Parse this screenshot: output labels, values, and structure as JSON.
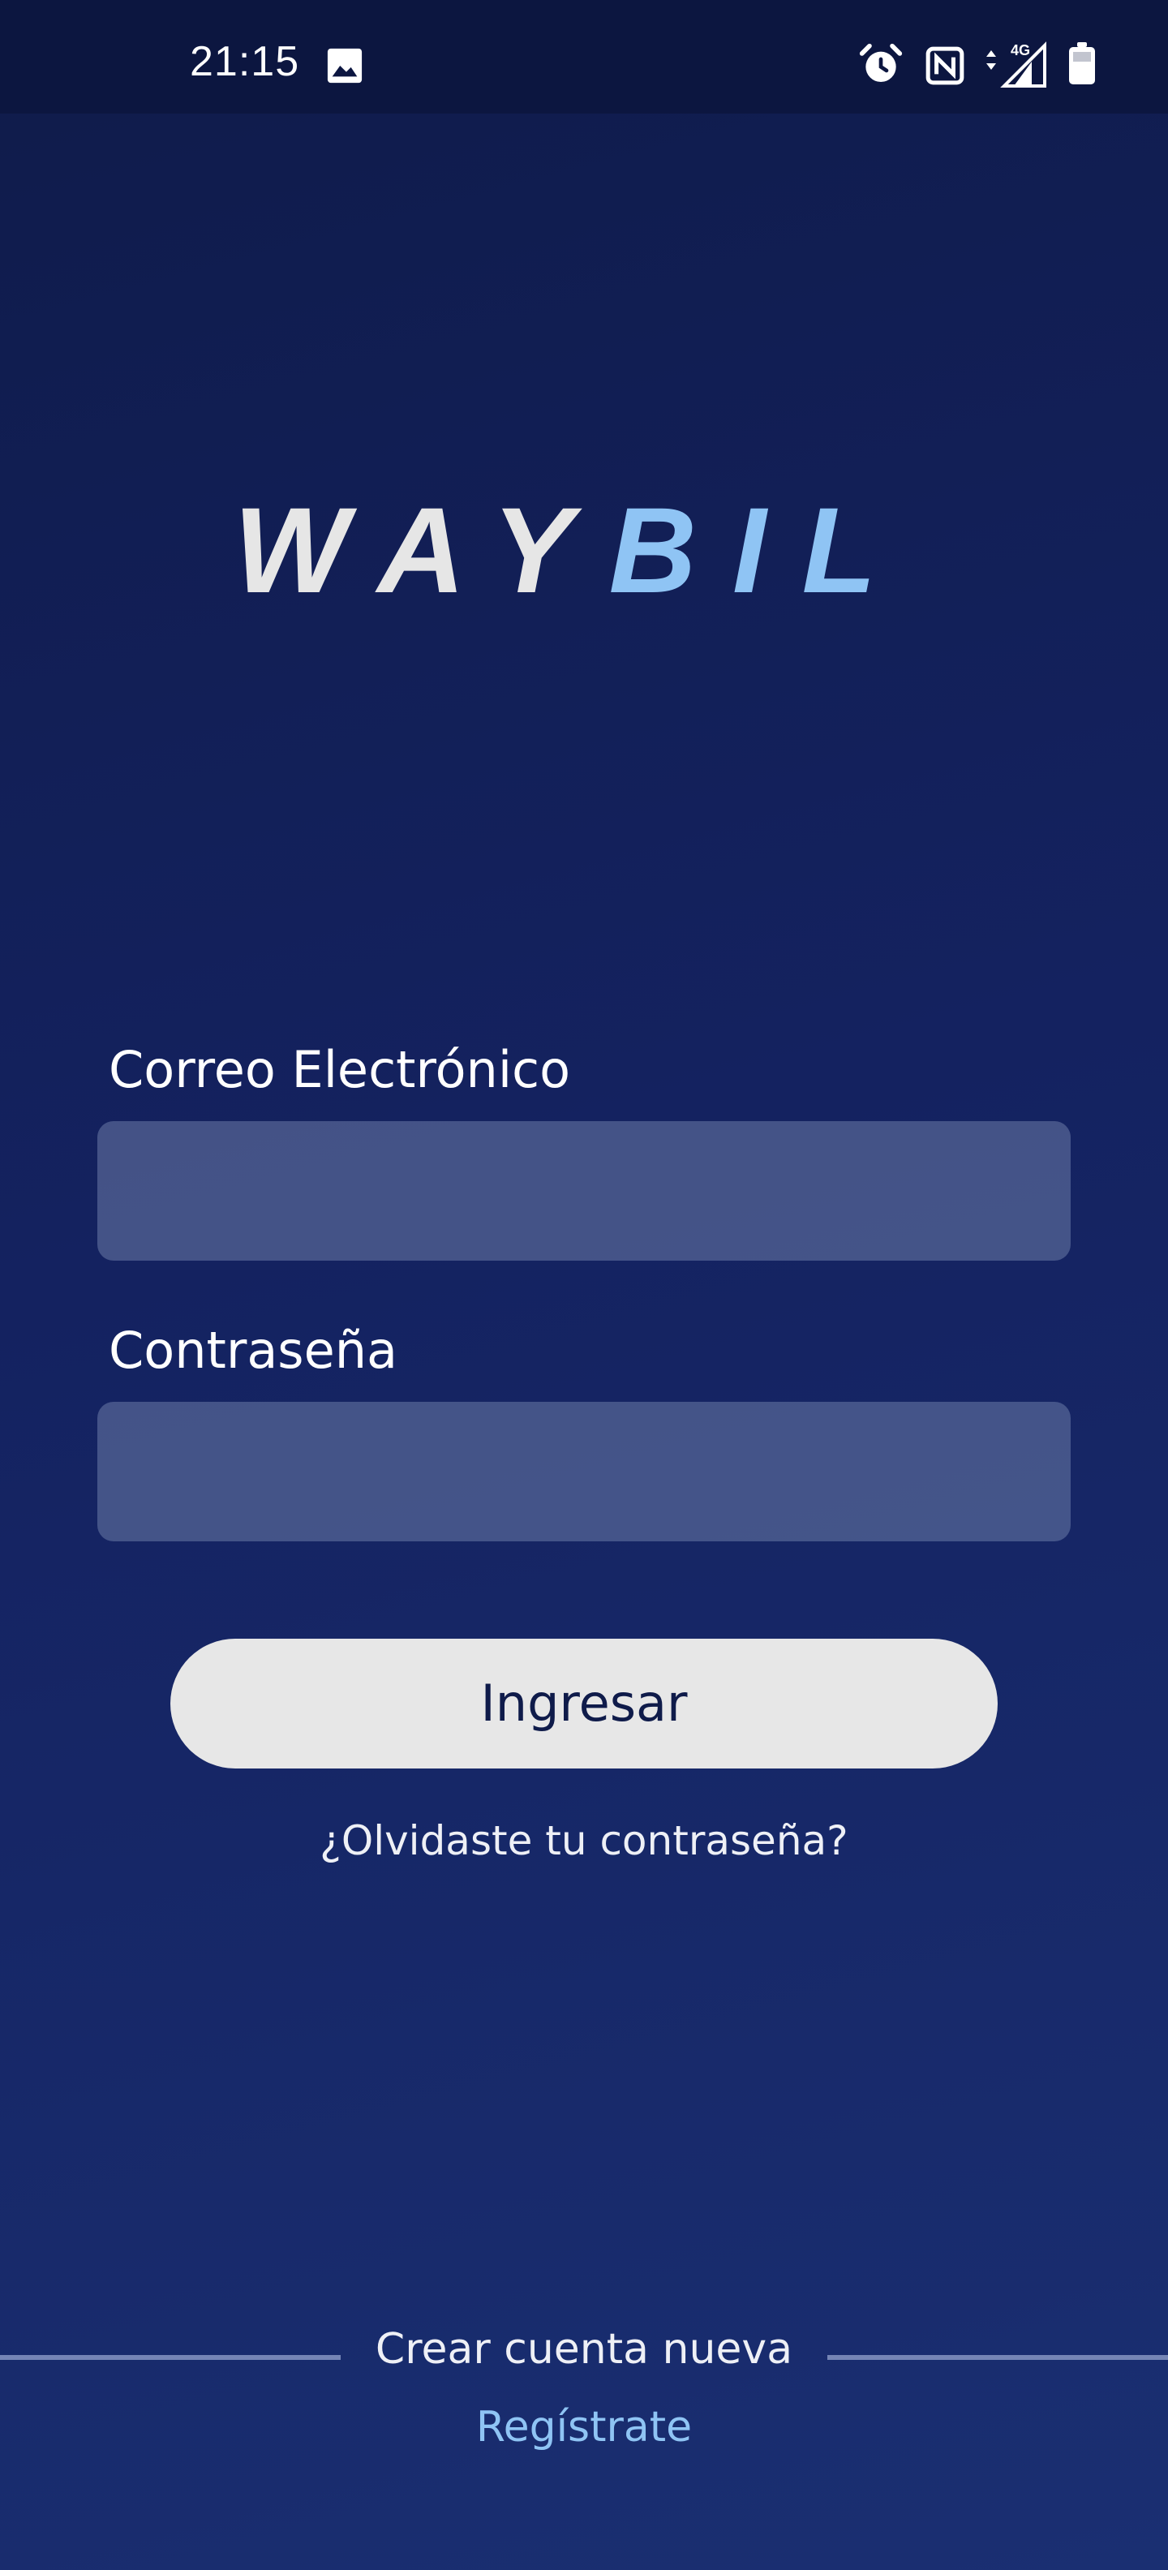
{
  "status_bar": {
    "time": "21:15",
    "icons": [
      "image-icon",
      "alarm-icon",
      "nfc-icon",
      "signal-4g-icon",
      "battery-icon"
    ],
    "network": "4G"
  },
  "logo": {
    "text_part1": "WAY",
    "text_part2": "BIL",
    "color_part1": "#e6e6e6",
    "color_part2": "#8fc4f4"
  },
  "form": {
    "email_label": "Correo Electrónico",
    "email_value": "",
    "password_label": "Contraseña",
    "password_value": "",
    "submit_label": "Ingresar",
    "forgot_label": "¿Olvidaste tu contraseña?"
  },
  "footer": {
    "create_account_label": "Crear cuenta nueva",
    "register_label": "Regístrate"
  },
  "colors": {
    "background_top": "#0f1b4a",
    "background_bottom": "#1a2f72",
    "accent": "#8fc4f4",
    "button": "#e7e7e7"
  }
}
